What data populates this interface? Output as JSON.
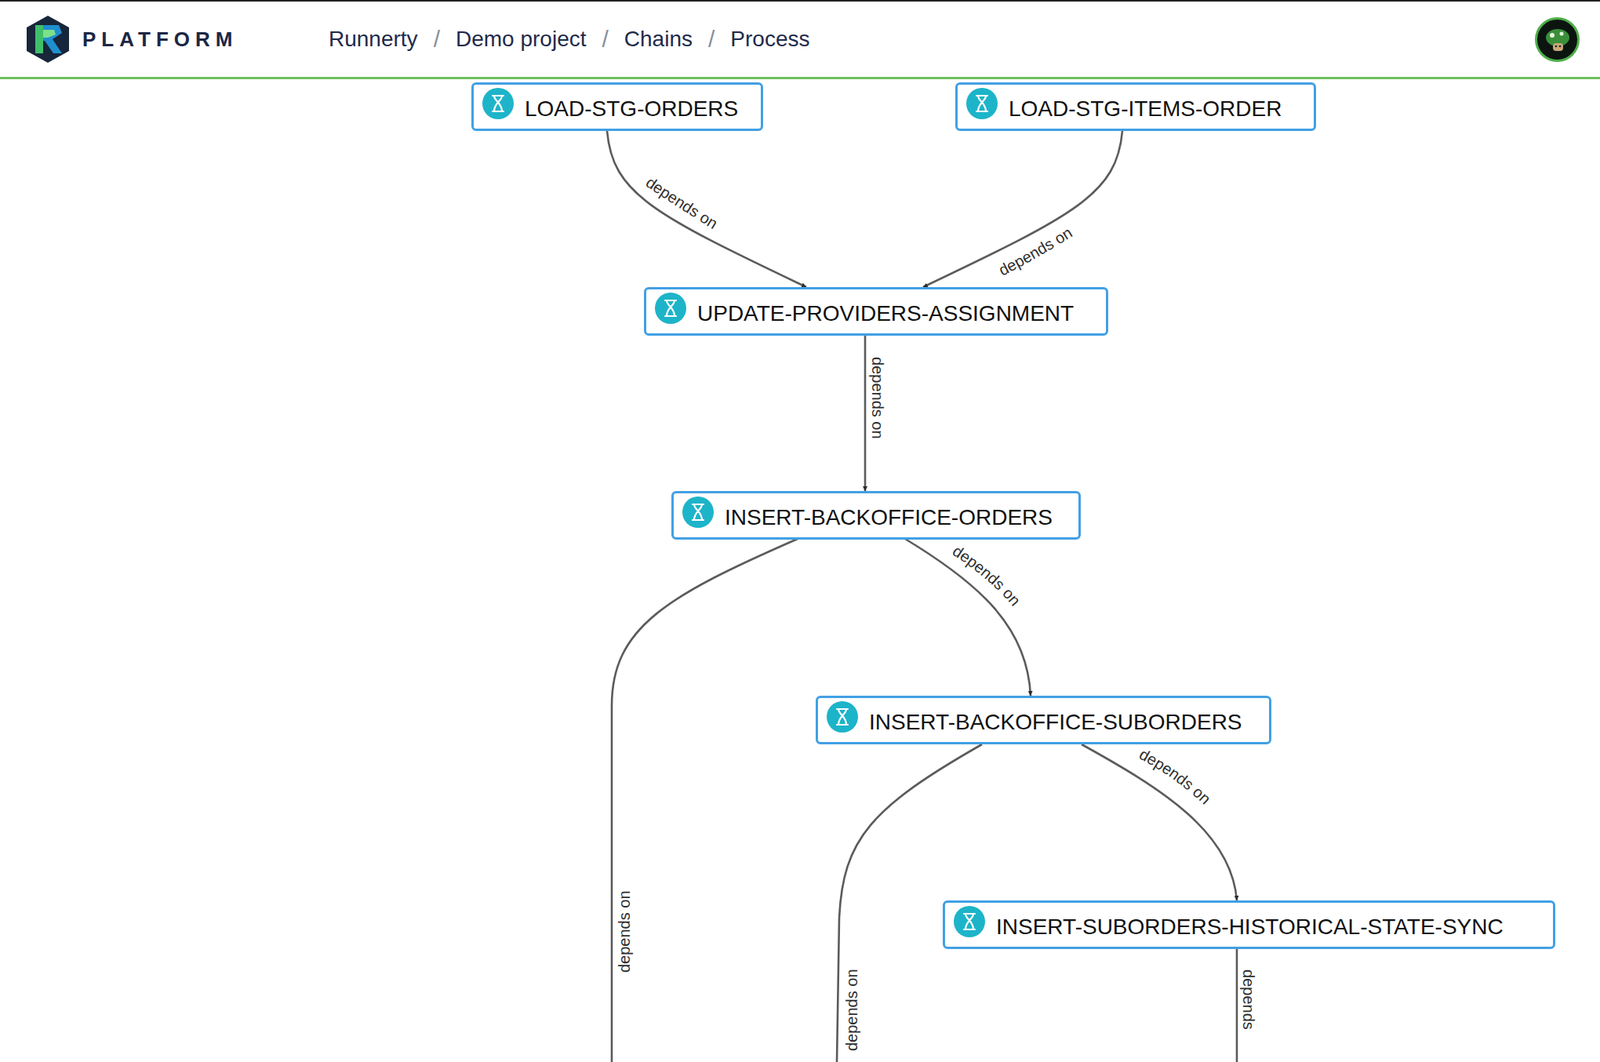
{
  "header": {
    "logo": "PLATFORM",
    "separator": "/",
    "breadcrumbs": [
      {
        "label": "Runnerty"
      },
      {
        "label": "Demo project"
      },
      {
        "label": "Chains"
      },
      {
        "label": "Process"
      }
    ]
  },
  "nodes": [
    {
      "name": "LOAD-STG-ORDERS",
      "status": "waiting"
    },
    {
      "name": "LOAD-STG-ITEMS-ORDER",
      "status": "waiting"
    },
    {
      "name": "UPDATE-PROVIDERS-ASSIGNMENT",
      "status": "waiting"
    },
    {
      "name": "INSERT-BACKOFFICE-ORDERS",
      "status": "waiting"
    },
    {
      "name": "INSERT-BACKOFFICE-SUBORDERS",
      "status": "waiting"
    },
    {
      "name": "INSERT-SUBORDERS-HISTORICAL-STATE-SYNC",
      "status": "waiting"
    }
  ],
  "edges": [
    {
      "from": "LOAD-STG-ORDERS",
      "to": "UPDATE-PROVIDERS-ASSIGNMENT",
      "label": "depends on"
    },
    {
      "from": "LOAD-STG-ITEMS-ORDER",
      "to": "UPDATE-PROVIDERS-ASSIGNMENT",
      "label": "depends on"
    },
    {
      "from": "UPDATE-PROVIDERS-ASSIGNMENT",
      "to": "INSERT-BACKOFFICE-ORDERS",
      "label": "depends on"
    },
    {
      "from": "INSERT-BACKOFFICE-ORDERS",
      "to": "INSERT-BACKOFFICE-SUBORDERS",
      "label": "depends on"
    },
    {
      "from": "INSERT-BACKOFFICE-ORDERS",
      "to": null,
      "label": "depends on"
    },
    {
      "from": "INSERT-BACKOFFICE-SUBORDERS",
      "to": "INSERT-SUBORDERS-HISTORICAL-STATE-SYNC",
      "label": "depends on"
    },
    {
      "from": "INSERT-BACKOFFICE-SUBORDERS",
      "to": null,
      "label": "depends on"
    },
    {
      "from": "INSERT-SUBORDERS-HISTORICAL-STATE-SYNC",
      "to": null,
      "label": "depends"
    }
  ]
}
